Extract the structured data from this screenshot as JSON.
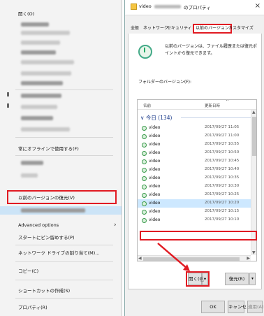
{
  "context_menu": {
    "open_label": "開く(O)",
    "always_offline": "常にオフラインで使用する(F)",
    "restore_previous": "以前のバージョンの復元(V)",
    "advanced_options": "Advanced options",
    "pin_to_start": "スタートにピン留めする(P)",
    "map_network_drive": "ネットワーク ドライブの割り当て(M)...",
    "copy": "コピー(C)",
    "create_shortcut": "ショートカットの作成(S)",
    "properties": "プロパティ(R)"
  },
  "dialog": {
    "title_prefix": "video",
    "title_suffix": "のプロパティ",
    "close_glyph": "×",
    "tabs": [
      "全般",
      "ネットワーク",
      "セキュリティ",
      "以前のバージョン",
      "カスタマイズ"
    ],
    "active_tab_index": 3,
    "info_text": "以前のバージョンは、ファイル履歴または復元ポイントから復元できます。",
    "folder_versions_label": "フォルダーのバージョン(F):",
    "list": {
      "col_name": "名前",
      "col_date": "更新日時",
      "group_label": "今日 (134)",
      "rows": [
        {
          "name": "video",
          "date": "2017/09/27 11:05"
        },
        {
          "name": "video",
          "date": "2017/09/27 11:00"
        },
        {
          "name": "video",
          "date": "2017/09/27 10:55"
        },
        {
          "name": "video",
          "date": "2017/09/27 10:50"
        },
        {
          "name": "video",
          "date": "2017/09/27 10:45"
        },
        {
          "name": "video",
          "date": "2017/09/27 10:40"
        },
        {
          "name": "video",
          "date": "2017/09/27 10:35"
        },
        {
          "name": "video",
          "date": "2017/09/27 10:30"
        },
        {
          "name": "video",
          "date": "2017/09/27 10:25"
        },
        {
          "name": "video",
          "date": "2017/09/27 10:20"
        },
        {
          "name": "video",
          "date": "2017/09/27 10:15"
        },
        {
          "name": "video",
          "date": "2017/09/27 10:10"
        }
      ],
      "selected_row_index": 9
    },
    "open_button": "開く(O)",
    "open_dropdown_glyph": "▾",
    "restore_button": "復元(R)",
    "restore_dropdown_glyph": "▾",
    "ok_button": "OK",
    "cancel_button": "キャンセル",
    "apply_button": "適用(A)"
  },
  "colors": {
    "highlight_red": "#e11a22",
    "selection_blue": "#cde8ff"
  }
}
